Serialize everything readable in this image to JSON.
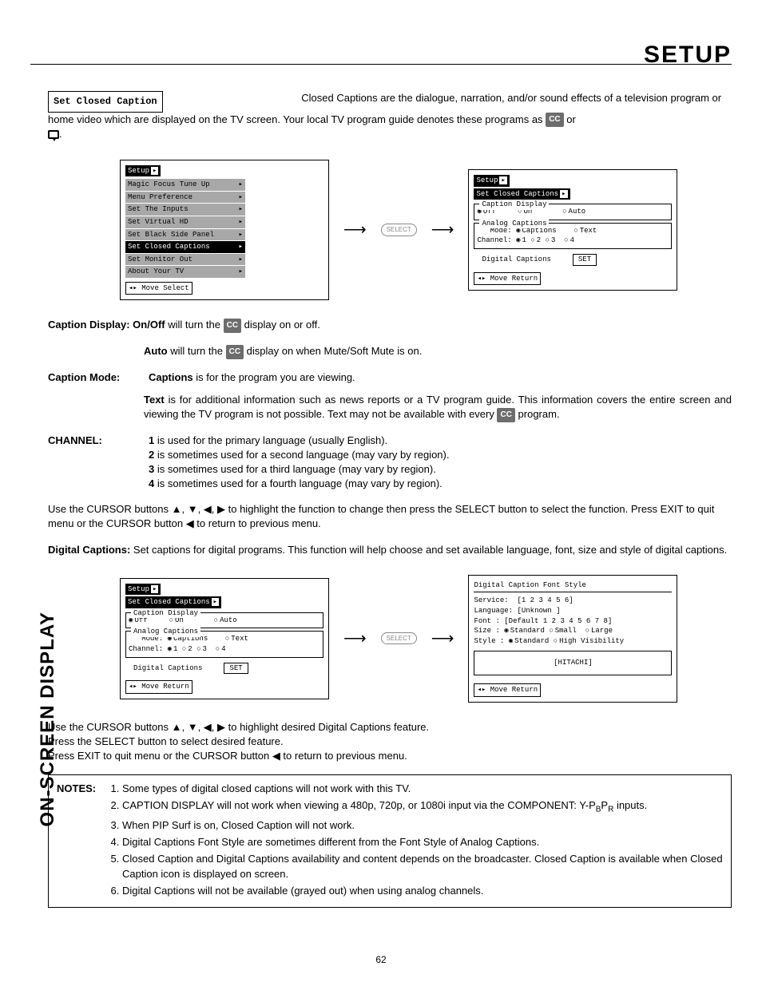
{
  "page_title": "SETUP",
  "sidebar_label": "ON-SCREEN DISPLAY",
  "page_number": "62",
  "set_closed_caption_badge": "Set Closed Caption",
  "intro_p1": "Closed Captions are the dialogue, narration, and/or sound effects of a television program or home video which are displayed on the TV screen.  Your local TV program guide denotes these programs as",
  "intro_or": "or",
  "intro_period": ".",
  "cc_label": "CC",
  "osd1": {
    "title": "Setup",
    "items": [
      "Magic Focus Tune Up",
      "Menu Preference",
      "Set The Inputs",
      "Set Virtual HD",
      "Set Black Side Panel",
      "Set Closed Captions",
      "Set Monitor Out",
      "About Your TV"
    ],
    "selected": "Set Closed Captions",
    "footer": "Move     Select"
  },
  "select_label": "SELECT",
  "osd2": {
    "title": "Setup",
    "sub": "Set Closed Captions",
    "cap_disp_label": "Caption Display",
    "off": "Off",
    "on": "On",
    "auto": "Auto",
    "analog_label": "Analog Captions",
    "mode_label": "Mode:",
    "captions": "Captions",
    "text": "Text",
    "channel_label": "Channel:",
    "ch": [
      "1",
      "2",
      "3",
      "4"
    ],
    "digital": "Digital Captions",
    "set": "SET",
    "footer": "Move     Return"
  },
  "cap_disp_heading": "Caption Display: On/Off",
  "cap_disp_rest": " will turn the ",
  "cap_disp_tail": " display on or off.",
  "auto_label": "Auto",
  "auto_rest": " will turn the ",
  "auto_tail": " display on when Mute/Soft Mute is on.",
  "cap_mode_dt": "Caption Mode:",
  "cap_mode_captions_b": "Captions",
  "cap_mode_captions_rest": " is for the program you are viewing.",
  "cap_mode_text_b": "Text",
  "cap_mode_text_rest": " is for additional information such as news reports or a TV program guide.  This information covers the entire screen and viewing the TV program is not possible.  Text may not be available with every ",
  "cap_mode_text_tail": " program.",
  "channel_dt": "CHANNEL:",
  "channel_lines": [
    {
      "b": "1",
      "rest": " is used for the primary language (usually English)."
    },
    {
      "b": "2",
      "rest": " is sometimes used for a second language (may vary by region)."
    },
    {
      "b": "3",
      "rest": " is sometimes used for a third language (may vary by region)."
    },
    {
      "b": "4",
      "rest": " is sometimes used for a fourth language (may vary by region)."
    }
  ],
  "cursor_p": "Use the CURSOR buttons ▲, ▼, ◀, ▶ to highlight the function to change then press the SELECT button to select the function.  Press EXIT to quit menu or the CURSOR button ◀ to return to previous menu.",
  "dig_cap_b": "Digital Captions:",
  "dig_cap_rest": "  Set captions for digital programs.  This function will help choose and set  available language, font, size and style of digital captions.",
  "osd3_same_as_osd2": true,
  "osd4": {
    "title": "Digital Caption Font Style",
    "service_l": "Service:",
    "service_v": "[1 2 3 4 5 6]",
    "lang_l": "Language:",
    "lang_v": "[Unknown    ]",
    "font_l": "Font    :",
    "font_v": "[Default 1 2 3 4 5 6 7 8]",
    "size_l": "Size    :",
    "size_std": "Standard",
    "size_sm": "Small",
    "size_lg": "Large",
    "style_l": "Style   :",
    "style_std": "Standard",
    "style_hv": "High Visibility",
    "preview": "[HITACHI]",
    "footer": "Move     Return"
  },
  "dc_cursor1": "Use the CURSOR buttons ▲, ▼, ◀, ▶ to highlight desired Digital Captions feature.",
  "dc_cursor2": "Press the SELECT button to select desired feature.",
  "dc_cursor3": "Press EXIT to quit menu or the CURSOR button ◀ to return to previous menu.",
  "notes_label": "NOTES:",
  "notes": [
    "Some types of digital closed captions will not work with this TV.",
    "CAPTION DISPLAY will not work when viewing a 480p, 720p, or 1080i input via the COMPONENT: Y-PBPR inputs.",
    "When PIP Surf is on, Closed Caption will not work.",
    "Digital Captions Font Style are sometimes different from the Font Style of Analog Captions.",
    "Closed Caption and Digital Captions availability and content depends on the broadcaster.  Closed Caption is available when Closed Caption icon is displayed on screen.",
    "Digital Captions will not be available (grayed out) when using analog channels."
  ]
}
